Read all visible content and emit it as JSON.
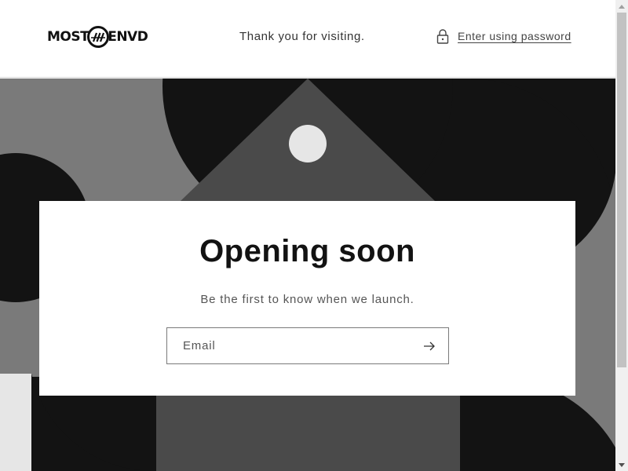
{
  "header": {
    "logo_left": "MOST",
    "logo_right": "ENVD",
    "tagline": "Thank you for visiting.",
    "password_link": "Enter using password",
    "lock_icon": "lock-icon"
  },
  "hero": {
    "colors": {
      "dark": "#131313",
      "mid": "#4a4a4a",
      "gray": "#7a7a7a",
      "light": "#e6e6e6"
    }
  },
  "card": {
    "title": "Opening soon",
    "subtitle": "Be the first to know when we launch.",
    "email_placeholder": "Email",
    "submit_icon": "arrow-right-icon"
  }
}
